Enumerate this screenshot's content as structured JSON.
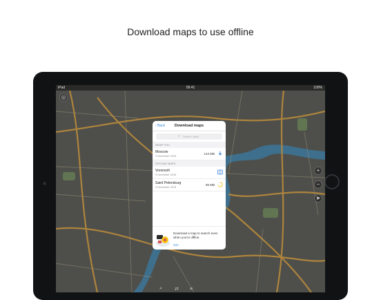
{
  "headline": "Download maps to use offline",
  "status_bar": {
    "carrier": "iPad",
    "time": "09:41",
    "battery": "100%"
  },
  "panel": {
    "back_label": "Back",
    "title": "Download maps",
    "search_placeholder": "Search cities",
    "near_you_header": "NEAR YOU",
    "near_you": [
      {
        "name": "Moscow",
        "date": "9 November 2016",
        "size": "144 MB",
        "action": "download-icon"
      }
    ],
    "offline_header": "OFFLINE MAPS",
    "offline": [
      {
        "name": "Voronezh",
        "date": "9 November 2016",
        "size": "",
        "action": "map-icon"
      },
      {
        "name": "Saint Petersburg",
        "date": "9 November 2016",
        "size": "85 MB",
        "action": "progress-icon"
      }
    ],
    "footer_message": "Download a map to search even when you're offline.",
    "footer_ok": "OK!"
  },
  "colors": {
    "accent": "#3a86d8",
    "progress": "#f5c518",
    "map_bg": "#4e4f4a",
    "road": "#b98a3c",
    "river": "#3e6f8c"
  }
}
